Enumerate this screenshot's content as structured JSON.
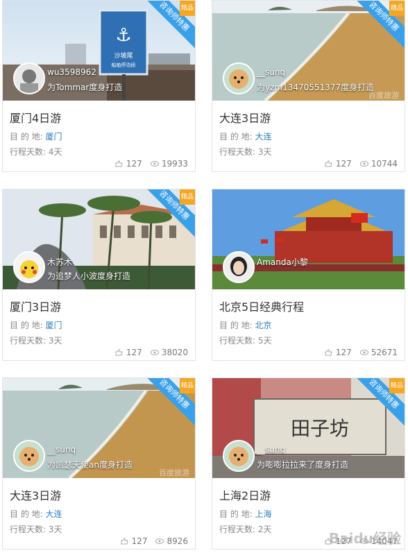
{
  "ribbon": {
    "text": "咨询师特惠",
    "tag": "精品"
  },
  "labels": {
    "destination": "目 的 地:",
    "days": "行程天数:"
  },
  "photo_watermark": "百度旅游",
  "cards": [
    {
      "user": "wu3598962",
      "made_for": "为Tommar度身打造",
      "title": "厦门4日游",
      "destination": "厦门",
      "days": "4天",
      "likes": "127",
      "views": "19933"
    },
    {
      "user": "__sunq",
      "made_for": "为yzm13470551377度身打造",
      "title": "大连3日游",
      "destination": "大连",
      "days": "3天",
      "likes": "127",
      "views": "10744"
    },
    {
      "user": "木苏木",
      "made_for": "为追梦人小波度身打造",
      "title": "厦门3日游",
      "destination": "厦门",
      "days": "3天",
      "likes": "127",
      "views": "38020"
    },
    {
      "user": "Amanda小黎",
      "made_for": "",
      "title": "北京5日经典行程",
      "destination": "北京",
      "days": "5天",
      "likes": "127",
      "views": "52671"
    },
    {
      "user": "__sunq",
      "made_for": "为凯瑟天使an度身打造",
      "title": "大连3日游",
      "destination": "大连",
      "days": "3天",
      "likes": "127",
      "views": "8926"
    },
    {
      "user": "__sunq",
      "made_for": "为嘭嘭拉拉来了度身打造",
      "title": "上海2日游",
      "destination": "上海",
      "days": "2天",
      "likes": "127",
      "views": "14047"
    }
  ],
  "footer_watermark": "Baidu经验",
  "icons": [
    "like-icon",
    "view-icon"
  ],
  "colors": {
    "accent_blue": "#2a7dc0",
    "ribbon_blue": "#3aa0e8",
    "ribbon_tag": "#f5a623"
  }
}
